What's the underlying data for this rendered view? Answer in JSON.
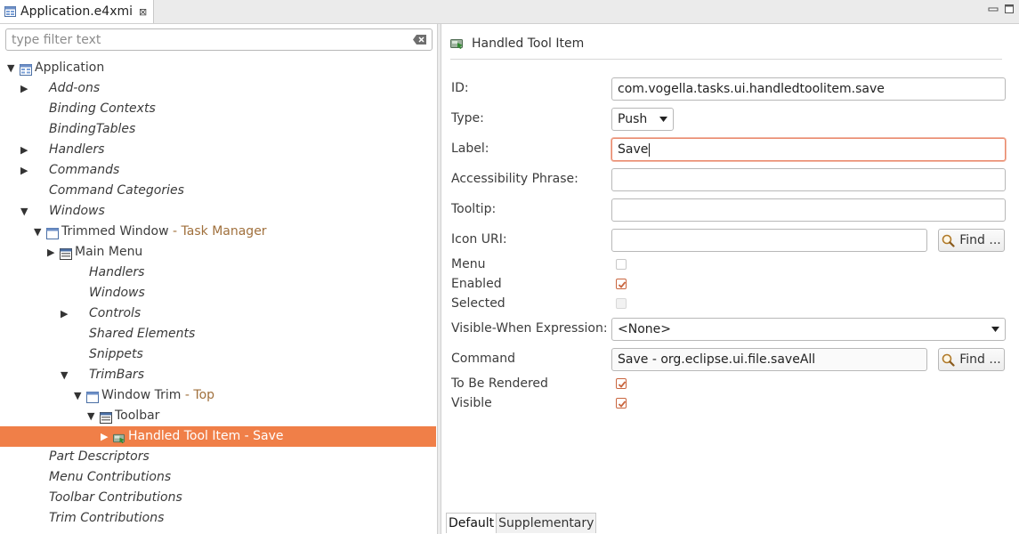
{
  "editor_tab": {
    "title": "Application.e4xmi",
    "close_glyph": "⊠",
    "icon": "model-file-icon"
  },
  "filter": {
    "placeholder": "type filter text",
    "value": ""
  },
  "tree": [
    {
      "label": "Application",
      "italic": false,
      "depth": 0,
      "twisty": "expanded",
      "icon": "application-icon"
    },
    {
      "label": "Add-ons",
      "italic": true,
      "depth": 1,
      "twisty": "collapsed"
    },
    {
      "label": "Binding Contexts",
      "italic": true,
      "depth": 1,
      "twisty": "none"
    },
    {
      "label": "BindingTables",
      "italic": true,
      "depth": 1,
      "twisty": "none"
    },
    {
      "label": "Handlers",
      "italic": true,
      "depth": 1,
      "twisty": "collapsed"
    },
    {
      "label": "Commands",
      "italic": true,
      "depth": 1,
      "twisty": "collapsed"
    },
    {
      "label": "Command Categories",
      "italic": true,
      "depth": 1,
      "twisty": "none"
    },
    {
      "label": "Windows",
      "italic": true,
      "depth": 1,
      "twisty": "expanded"
    },
    {
      "label": "Trimmed Window",
      "deco": " - Task Manager",
      "italic": false,
      "depth": 2,
      "twisty": "expanded",
      "icon": "window-icon"
    },
    {
      "label": "Main Menu",
      "italic": false,
      "depth": 3,
      "twisty": "collapsed",
      "icon": "menu-icon"
    },
    {
      "label": "Handlers",
      "italic": true,
      "depth": 4,
      "twisty": "none"
    },
    {
      "label": "Windows",
      "italic": true,
      "depth": 4,
      "twisty": "none"
    },
    {
      "label": "Controls",
      "italic": true,
      "depth": 4,
      "twisty": "collapsed"
    },
    {
      "label": "Shared Elements",
      "italic": true,
      "depth": 4,
      "twisty": "none"
    },
    {
      "label": "Snippets",
      "italic": true,
      "depth": 4,
      "twisty": "none"
    },
    {
      "label": "TrimBars",
      "italic": true,
      "depth": 4,
      "twisty": "expanded"
    },
    {
      "label": "Window Trim",
      "deco": " - Top",
      "italic": false,
      "depth": 5,
      "twisty": "expanded",
      "icon": "window-icon"
    },
    {
      "label": "Toolbar",
      "italic": false,
      "depth": 6,
      "twisty": "expanded",
      "icon": "menu-icon"
    },
    {
      "label": "Handled Tool Item - Save",
      "italic": false,
      "depth": 7,
      "twisty": "collapsed",
      "icon": "handled-tool-item-icon",
      "selected": true
    },
    {
      "label": "Part Descriptors",
      "italic": true,
      "depth": 1,
      "twisty": "none"
    },
    {
      "label": "Menu Contributions",
      "italic": true,
      "depth": 1,
      "twisty": "none"
    },
    {
      "label": "Toolbar Contributions",
      "italic": true,
      "depth": 1,
      "twisty": "none"
    },
    {
      "label": "Trim Contributions",
      "italic": true,
      "depth": 1,
      "twisty": "none"
    }
  ],
  "details": {
    "title": "Handled Tool Item",
    "id_label": "ID:",
    "id_value": "com.vogella.tasks.ui.handledtoolitem.save",
    "type_label": "Type:",
    "type_value": "Push",
    "label_label": "Label:",
    "label_value": "Save",
    "accessibility_label": "Accessibility Phrase:",
    "accessibility_value": "",
    "tooltip_label": "Tooltip:",
    "tooltip_value": "",
    "icon_uri_label": "Icon URI:",
    "icon_uri_value": "",
    "find_label": "Find ...",
    "menu_label": "Menu",
    "menu_checked": false,
    "enabled_label": "Enabled",
    "enabled_checked": true,
    "selected_label": "Selected",
    "selected_checked": false,
    "vwe_label": "Visible-When Expression:",
    "vwe_value": "<None>",
    "command_label": "Command",
    "command_value": "Save - org.eclipse.ui.file.saveAll",
    "to_be_rendered_label": "To Be Rendered",
    "to_be_rendered_checked": true,
    "visible_label": "Visible",
    "visible_checked": true
  },
  "bottom_tabs": {
    "default": "Default",
    "supplementary": "Supplementary",
    "active": "default"
  },
  "colors": {
    "selection": "#f07f48",
    "decoration": "#a0703c",
    "check": "#c9663f",
    "focus_border": "#e9876a"
  }
}
